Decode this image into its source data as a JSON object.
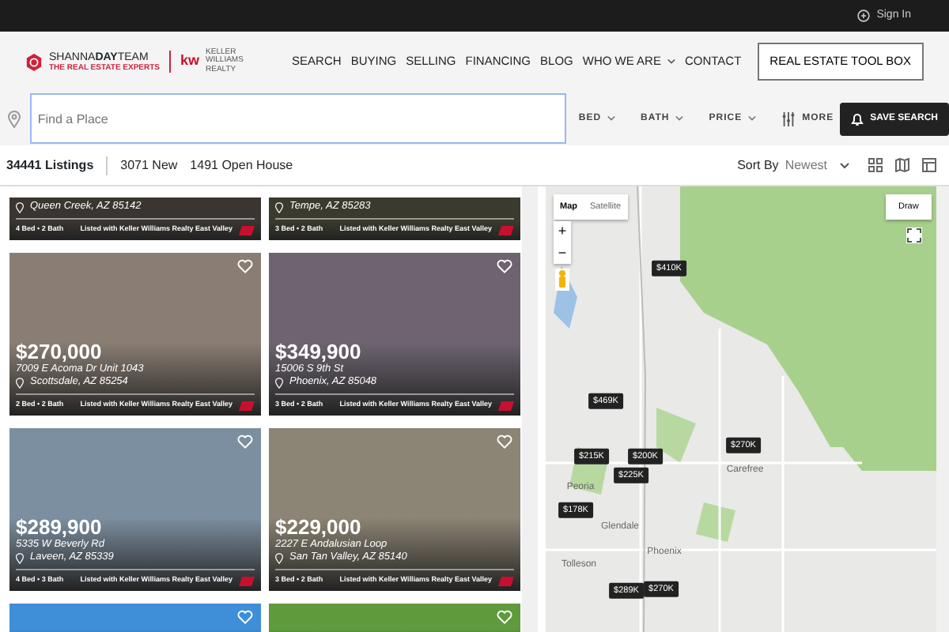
{
  "top_bar": {
    "sign_in": "Sign In"
  },
  "header": {
    "brand": "SHANNA**DAY**TEAM",
    "tagline": "THE REAL ESTATE EXPERTS",
    "partner_logo": "kw",
    "partner_text": "KELLER WILLIAMS REALTY",
    "nav": [
      {
        "label": "SEARCH",
        "dropdown": false
      },
      {
        "label": "BUYING",
        "dropdown": false
      },
      {
        "label": "SELLING",
        "dropdown": false
      },
      {
        "label": "FINANCING",
        "dropdown": false
      },
      {
        "label": "BLOG",
        "dropdown": false
      },
      {
        "label": "WHO WE ARE",
        "dropdown": true
      },
      {
        "label": "CONTACT",
        "dropdown": false
      }
    ],
    "cta": "REAL ESTATE TOOL BOX"
  },
  "search": {
    "placeholder": "Find a Place",
    "filters": [
      {
        "label": "BED",
        "kind": "dropdown"
      },
      {
        "label": "BATH",
        "kind": "dropdown"
      },
      {
        "label": "PRICE",
        "kind": "dropdown"
      },
      {
        "label": "MORE",
        "kind": "more"
      }
    ],
    "save": "SAVE SEARCH"
  },
  "summary": {
    "count": "34441 Listings",
    "new": "3071 New",
    "open_house": "1491 Open House",
    "sort_label": "Sort By",
    "sort_value": "Newest"
  },
  "listings": [
    {
      "kind": "partial",
      "city": "Queen Creek, AZ 85142",
      "beds_baths": "4 Bed • 2 Bath",
      "listed_with": "Listed with Keller Williams Realty East Valley"
    },
    {
      "kind": "partial",
      "city": "Tempe, AZ 85283",
      "beds_baths": "3 Bed • 2 Bath",
      "listed_with": "Listed with Keller Williams Realty East Valley"
    },
    {
      "kind": "full",
      "price": "$270,000",
      "street": "7009 E Acoma Dr Unit 1043",
      "city": "Scottsdale, AZ 85254",
      "beds_baths": "2 Bed • 2 Bath",
      "listed_with": "Listed with Keller Williams Realty East Valley"
    },
    {
      "kind": "full",
      "price": "$349,900",
      "street": "15006 S 9th St",
      "city": "Phoenix, AZ 85048",
      "beds_baths": "3 Bed • 2 Bath",
      "listed_with": "Listed with Keller Williams Realty East Valley"
    },
    {
      "kind": "full",
      "price": "$289,900",
      "street": "5335 W Beverly Rd",
      "city": "Laveen, AZ 85339",
      "beds_baths": "4 Bed • 3 Bath",
      "listed_with": "Listed with Keller Williams Realty East Valley"
    },
    {
      "kind": "full",
      "price": "$229,000",
      "street": "2227 E Andalusian Loop",
      "city": "San Tan Valley, AZ 85140",
      "beds_baths": "3 Bed • 2 Bath",
      "listed_with": "Listed with Keller Williams Realty East Valley"
    },
    {
      "kind": "photo"
    },
    {
      "kind": "photo"
    }
  ],
  "map": {
    "types": [
      {
        "label": "Map",
        "selected": true
      },
      {
        "label": "Satellite",
        "selected": false
      }
    ],
    "zoom_in": "+",
    "zoom_out": "−",
    "draw": "Draw",
    "places": [
      "Carefree",
      "Peoria",
      "Glendale",
      "Tolleson",
      "Phoenix"
    ],
    "pins": [
      "$410K",
      "$469K",
      "$215K",
      "$200K",
      "$225K",
      "$270K",
      "$178K",
      "$289K",
      "$270K"
    ]
  }
}
